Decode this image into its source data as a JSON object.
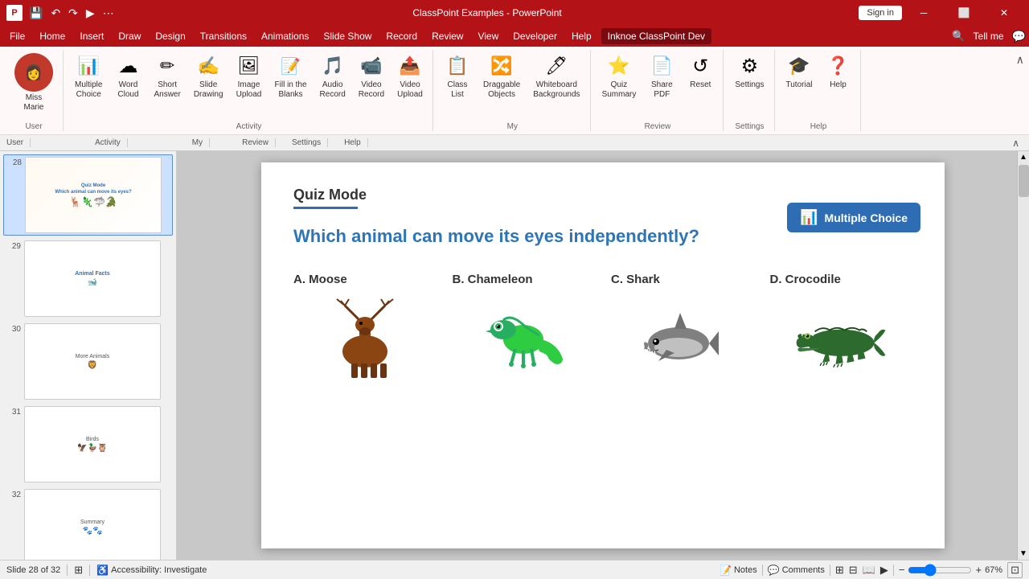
{
  "titlebar": {
    "title": "ClassPoint Examples - PowerPoint",
    "sign_in": "Sign in",
    "quick_access_icons": [
      "save",
      "undo",
      "redo",
      "present"
    ]
  },
  "menubar": {
    "items": [
      "File",
      "Home",
      "Insert",
      "Draw",
      "Design",
      "Transitions",
      "Animations",
      "Slide Show",
      "Record",
      "Review",
      "View",
      "Developer",
      "Help"
    ],
    "active": "Inknoe ClassPoint Dev",
    "tell_me": "Tell me"
  },
  "ribbon": {
    "groups": [
      {
        "label": "User",
        "items": [
          {
            "id": "user",
            "label": "Miss\nMarie",
            "icon": "👤"
          }
        ]
      },
      {
        "label": "Activity",
        "items": [
          {
            "id": "multiple-choice",
            "label": "Multiple\nChoice",
            "icon": "📊"
          },
          {
            "id": "word-cloud",
            "label": "Word\nCloud",
            "icon": "☁"
          },
          {
            "id": "short-answer",
            "label": "Short\nAnswer",
            "icon": "✏"
          },
          {
            "id": "slide-drawing",
            "label": "Slide\nDrawing",
            "icon": "✍"
          },
          {
            "id": "image-upload",
            "label": "Image\nUpload",
            "icon": "🖼"
          },
          {
            "id": "fill-blanks",
            "label": "Fill in the\nBlanks",
            "icon": "📝"
          },
          {
            "id": "audio-record",
            "label": "Audio\nRecord",
            "icon": "🎵"
          },
          {
            "id": "video-record",
            "label": "Video\nRecord",
            "icon": "📹"
          },
          {
            "id": "video-upload",
            "label": "Video\nUpload",
            "icon": "📤"
          }
        ]
      },
      {
        "label": "My",
        "items": [
          {
            "id": "class-list",
            "label": "Class\nList",
            "icon": "📋"
          },
          {
            "id": "draggable-objects",
            "label": "Draggable\nObjects",
            "icon": "🔀"
          },
          {
            "id": "whiteboard-bg",
            "label": "Whiteboard\nBackgrounds",
            "icon": "🖊"
          }
        ]
      },
      {
        "label": "Review",
        "items": [
          {
            "id": "quiz-summary",
            "label": "Quiz\nSummary",
            "icon": "⭐"
          },
          {
            "id": "share-pdf",
            "label": "Share\nPDF",
            "icon": "📄"
          },
          {
            "id": "reset",
            "label": "Reset",
            "icon": "↺"
          }
        ]
      },
      {
        "label": "Settings",
        "items": [
          {
            "id": "settings",
            "label": "Settings",
            "icon": "⚙"
          }
        ]
      },
      {
        "label": "Help",
        "items": [
          {
            "id": "tutorial",
            "label": "Tutorial",
            "icon": "🎓"
          },
          {
            "id": "help",
            "label": "Help",
            "icon": "❓"
          }
        ]
      }
    ]
  },
  "slide_panel": {
    "slides": [
      {
        "num": 28,
        "active": true,
        "label": "Quiz Mode - animals"
      },
      {
        "num": 29,
        "active": false,
        "label": "slide 29"
      },
      {
        "num": 30,
        "active": false,
        "label": "slide 30"
      },
      {
        "num": 31,
        "active": false,
        "label": "slide 31"
      },
      {
        "num": 32,
        "active": false,
        "label": "slide 32"
      }
    ]
  },
  "slide": {
    "mode_title": "Quiz Mode",
    "question": "Which animal can move its eyes independently?",
    "badge_label": "Multiple Choice",
    "answers": [
      {
        "letter": "A.",
        "label": "Moose",
        "emoji": "🦌"
      },
      {
        "letter": "B.",
        "label": "Chameleon",
        "emoji": "🦎"
      },
      {
        "letter": "C.",
        "label": "Shark",
        "emoji": "🦈"
      },
      {
        "letter": "D.",
        "label": "Crocodile",
        "emoji": "🐊"
      }
    ]
  },
  "statusbar": {
    "slide_info": "Slide 28 of 32",
    "accessibility": "Accessibility: Investigate",
    "notes": "Notes",
    "comments": "Comments",
    "zoom": "67%"
  }
}
